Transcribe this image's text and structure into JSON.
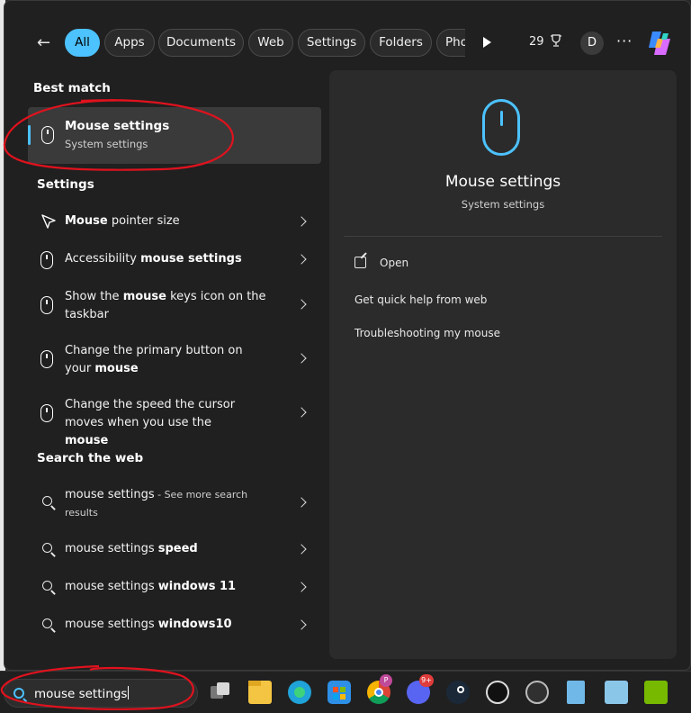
{
  "tabs": {
    "back_label": "←",
    "items": [
      {
        "label": "All",
        "active": true
      },
      {
        "label": "Apps"
      },
      {
        "label": "Documents"
      },
      {
        "label": "Web"
      },
      {
        "label": "Settings"
      },
      {
        "label": "Folders"
      },
      {
        "label": "Pho"
      }
    ],
    "points": "29",
    "avatar_initial": "D",
    "more_label": "···"
  },
  "best_match": {
    "heading": "Best match",
    "title": "Mouse settings",
    "subtitle": "System settings"
  },
  "settings": {
    "heading": "Settings",
    "items": [
      {
        "pre": "",
        "bold": "Mouse",
        "post": " pointer size"
      },
      {
        "pre": "Accessibility ",
        "bold": "mouse settings",
        "post": ""
      },
      {
        "pre": "Show the ",
        "bold": "mouse",
        "post": " keys icon on the taskbar"
      },
      {
        "pre": "Change the primary button on your ",
        "bold": "mouse",
        "post": ""
      },
      {
        "pre": "Change the speed the cursor moves when you use the ",
        "bold": "mouse",
        "post": ""
      }
    ]
  },
  "web": {
    "heading": "Search the web",
    "items": [
      {
        "pre": "mouse settings",
        "bold": "",
        "post": "",
        "small": " - See more search results"
      },
      {
        "pre": "mouse settings ",
        "bold": "speed",
        "post": ""
      },
      {
        "pre": "mouse settings ",
        "bold": "windows 11",
        "post": ""
      },
      {
        "pre": "mouse settings ",
        "bold": "windows10",
        "post": ""
      }
    ]
  },
  "preview": {
    "title": "Mouse settings",
    "subtitle": "System settings",
    "open_label": "Open",
    "links": [
      "Get quick help from web",
      "Troubleshooting my mouse"
    ]
  },
  "taskbar": {
    "search_value": "mouse settings",
    "chrome_badge": "P",
    "discord_badge": "9+"
  },
  "colors": {
    "accent": "#4cc2ff",
    "annotation": "#e0121e"
  }
}
